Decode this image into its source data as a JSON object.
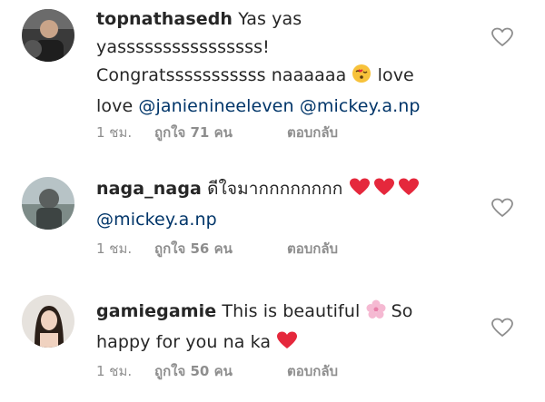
{
  "colors": {
    "username": "#262626",
    "text": "#262626",
    "mention": "#003569",
    "meta": "#8e8e8e",
    "heart_red": "#ed1c3a",
    "heart_outline": "#8e8e8e"
  },
  "comments": [
    {
      "username": "topnathasedh",
      "text_parts": [
        "Yas yas",
        "yassssssssssssssss!",
        "Congratsssssssssss naaaaaa",
        "love",
        "love"
      ],
      "mentions": [
        "@janienineeleven",
        "@mickey.a.np"
      ],
      "emoji": "kissing-face-icon",
      "time": "1 ชม.",
      "likes": "ถูกใจ 71 คน",
      "reply": "ตอบกลับ"
    },
    {
      "username": "naga_naga",
      "text_parts": [
        "ดีใจมากกกกกกกก"
      ],
      "mentions": [
        "@mickey.a.np"
      ],
      "emoji": "red-heart-icon x3",
      "time": "1 ชม.",
      "likes": "ถูกใจ 56 คน",
      "reply": "ตอบกลับ"
    },
    {
      "username": "gamiegamie",
      "text_parts": [
        "This is beautiful",
        "So",
        "happy for you na ka"
      ],
      "mentions": [],
      "emoji": "cherry-blossom-icon, red-heart-icon",
      "time": "1 ชม.",
      "likes": "ถูกใจ 50 คน",
      "reply": "ตอบกลับ"
    }
  ]
}
